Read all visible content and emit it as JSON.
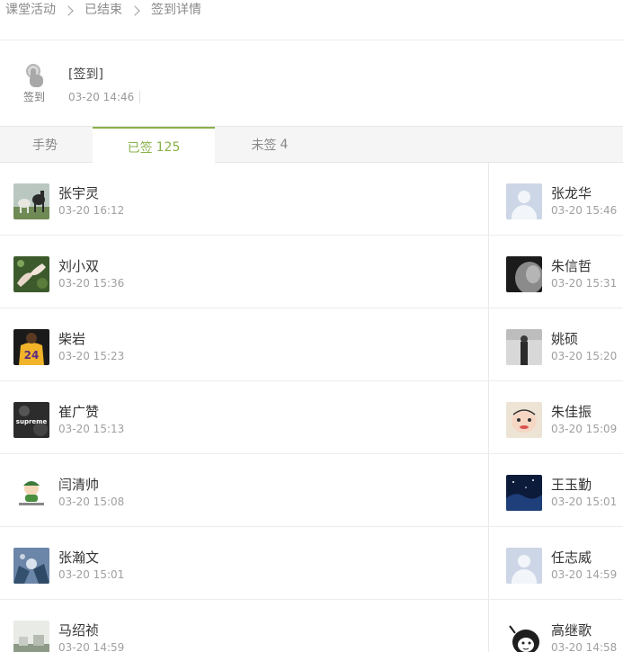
{
  "breadcrumb": {
    "items": [
      "课堂活动",
      "已结束",
      "签到详情"
    ]
  },
  "activity": {
    "icon_label": "签到",
    "title": "[签到]",
    "time": "03-20 14:46"
  },
  "tabs": {
    "gesture": "手势",
    "signed_label": "已签",
    "signed_count": "125",
    "unsigned_label": "未签",
    "unsigned_count": "4"
  },
  "rows": [
    {
      "left": {
        "name": "张宇灵",
        "time": "03-20 16:12",
        "avatar": "horses-photo"
      },
      "right": {
        "name": "张龙华",
        "time": "03-20 15:46",
        "avatar": "default-avatar"
      }
    },
    {
      "left": {
        "name": "刘小双",
        "time": "03-20 15:36",
        "avatar": "hands-photo"
      },
      "right": {
        "name": "朱信哲",
        "time": "03-20 15:31",
        "avatar": "bw-face-photo"
      }
    },
    {
      "left": {
        "name": "柴岩",
        "time": "03-20 15:23",
        "avatar": "jersey-24-photo"
      },
      "right": {
        "name": "姚硕",
        "time": "03-20 15:20",
        "avatar": "person-photo"
      }
    },
    {
      "left": {
        "name": "崔广赞",
        "time": "03-20 15:13",
        "avatar": "supreme-photo"
      },
      "right": {
        "name": "朱佳振",
        "time": "03-20 15:09",
        "avatar": "cartoon-face-photo"
      }
    },
    {
      "left": {
        "name": "闫清帅",
        "time": "03-20 15:08",
        "avatar": "cartoon-boy-photo"
      },
      "right": {
        "name": "王玉勤",
        "time": "03-20 15:01",
        "avatar": "night-sky-photo"
      }
    },
    {
      "left": {
        "name": "张瀚文",
        "time": "03-20 15:01",
        "avatar": "hands-blue-photo"
      },
      "right": {
        "name": "任志威",
        "time": "03-20 14:59",
        "avatar": "default-avatar"
      }
    },
    {
      "left": {
        "name": "马绍祯",
        "time": "03-20 14:59",
        "avatar": "landscape-photo"
      },
      "right": {
        "name": "高继歌",
        "time": "03-20 14:58",
        "avatar": "meme-face-photo"
      }
    }
  ],
  "colors": {
    "accent": "#8ab14a",
    "tab_bg": "#f5f5f5",
    "default_avatar": "#ccd6e6"
  }
}
